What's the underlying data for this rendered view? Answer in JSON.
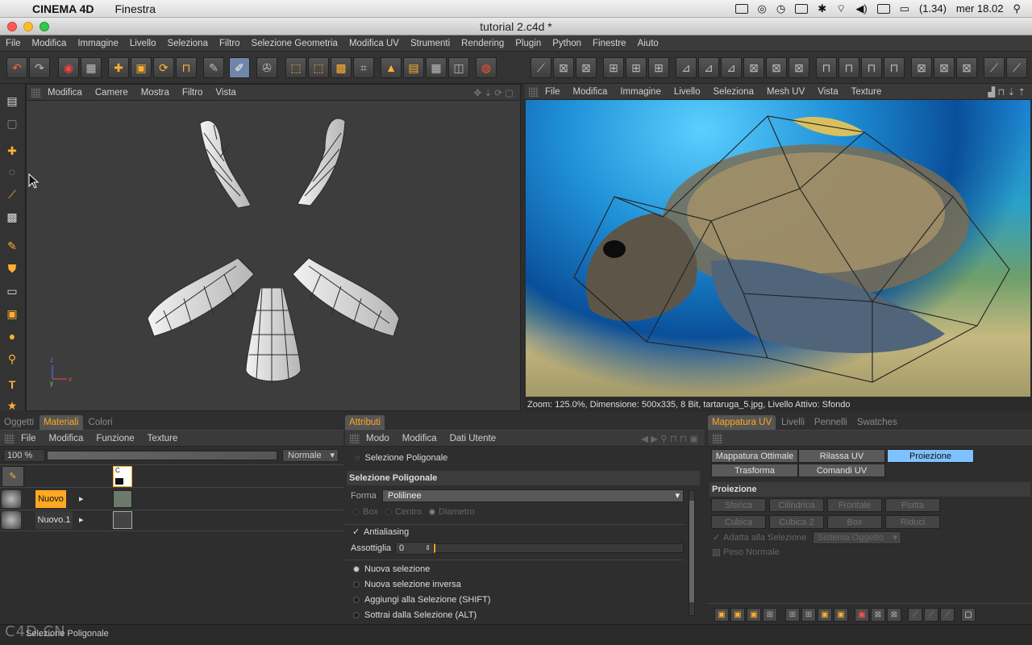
{
  "mac_menubar": {
    "app": "CINEMA 4D",
    "menu": "Finestra",
    "battery": "(1.34)",
    "clock": "mer 18.02"
  },
  "window": {
    "title": "tutorial 2.c4d *"
  },
  "main_menu": [
    "File",
    "Modifica",
    "Immagine",
    "Livello",
    "Seleziona",
    "Filtro",
    "Selezione Geometria",
    "Modifica UV",
    "Strumenti",
    "Rendering",
    "Plugin",
    "Python",
    "Finestre",
    "Aiuto"
  ],
  "viewport": {
    "menu": [
      "Modifica",
      "Camere",
      "Mostra",
      "Filtro",
      "Vista"
    ]
  },
  "texture_view": {
    "menu": [
      "File",
      "Modifica",
      "Immagine",
      "Livello",
      "Seleziona",
      "Mesh UV",
      "Vista",
      "Texture"
    ],
    "status": "Zoom: 125.0%, Dimensione: 500x335, 8 Bit, tartaruga_5.jpg, Livello Attivo: Sfondo"
  },
  "materials": {
    "tabs": [
      "Oggetti",
      "Materiali",
      "Colori"
    ],
    "menu": [
      "File",
      "Modifica",
      "Funzione",
      "Texture"
    ],
    "zoom": "100 %",
    "blend": "Normale",
    "layers": [
      "Nuovo",
      "Nuovo.1"
    ],
    "layer_c": "C"
  },
  "attributes": {
    "tab": "Attributi",
    "menu": [
      "Modo",
      "Modifica",
      "Dati Utente"
    ],
    "tool": "Selezione Poligonale",
    "section": "Selezione Poligonale",
    "forma_label": "Forma",
    "forma_value": "Polilinee",
    "sub_options": [
      "Box",
      "Centro",
      "Diametro"
    ],
    "antialiasing": "Antialiasing",
    "assottiglia_label": "Assottiglia",
    "assottiglia_value": "0",
    "modes": [
      "Nuova selezione",
      "Nuova selezione inversa",
      "Aggiungi alla Selezione (SHIFT)",
      "Sottrai dalla Selezione (ALT)"
    ]
  },
  "uv": {
    "tabs": [
      "Mappatura UV",
      "Livelli",
      "Pennelli",
      "Swatches"
    ],
    "buttons": [
      "Mappatura Ottimale",
      "Rilassa UV",
      "Proiezione",
      "Trasforma",
      "Comandi UV"
    ],
    "section": "Proiezione",
    "proj_buttons": [
      "Sferica",
      "Cilindrica",
      "Frontale",
      "Piatta",
      "Cubica",
      "Cubica 2",
      "Box",
      "Riduci"
    ],
    "adatta": "Adatta alla Selezione",
    "sistema": "Sistema Oggetto",
    "peso": "Peso Normale"
  },
  "statusbar": {
    "text": "Selezione Poligonale",
    "watermark": "C4D.CN"
  },
  "colors": {
    "accent": "#ffa820",
    "active_btn": "#7ec1ff"
  }
}
